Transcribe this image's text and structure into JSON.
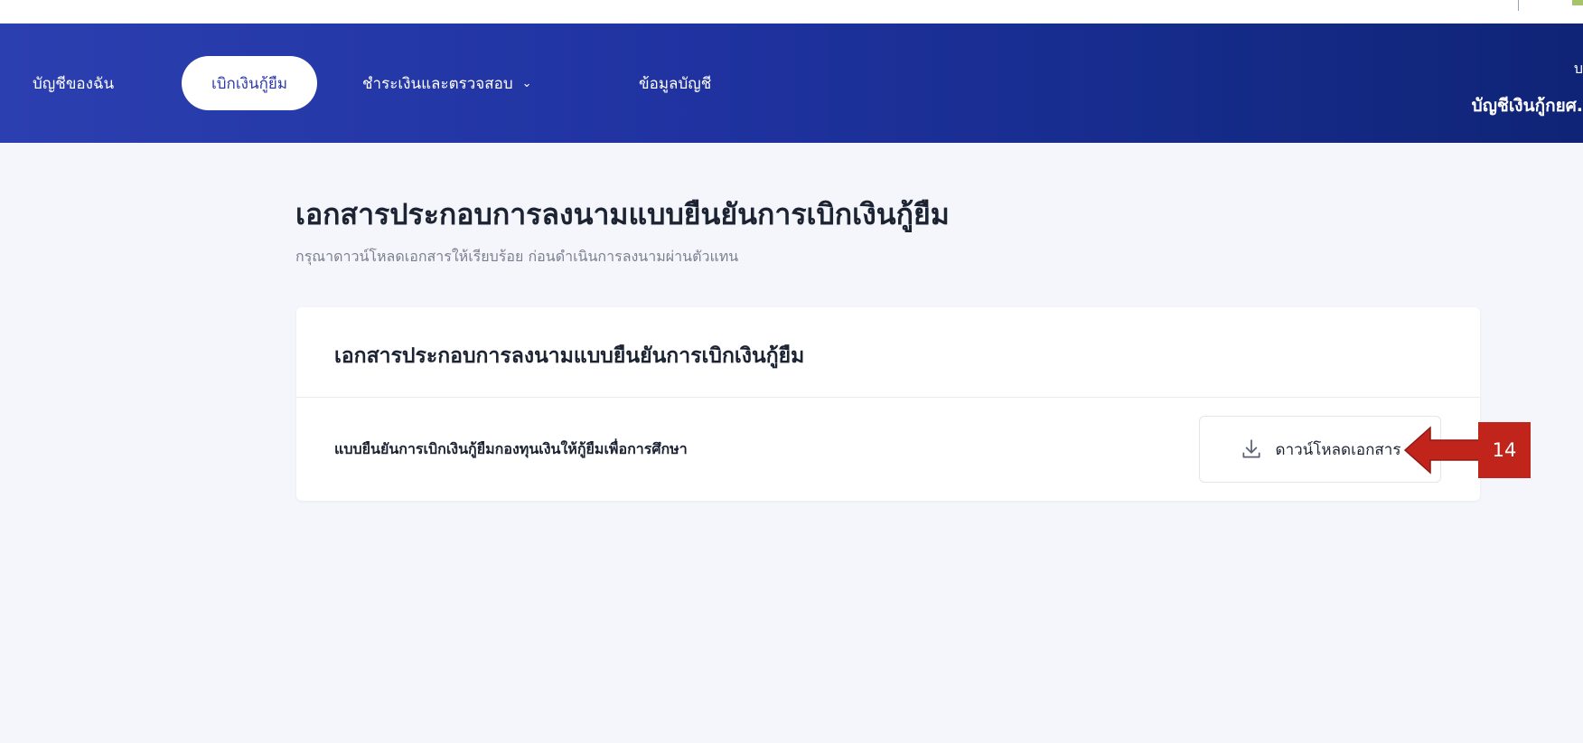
{
  "navbar": {
    "items": [
      {
        "label": "บัญชีของฉัน"
      },
      {
        "label": "เบิกเงินกู้ยืม",
        "active": true
      },
      {
        "label": "ชำระเงินและตรวจสอบ",
        "has_dropdown": true
      },
      {
        "label": "ข้อมูลบัญชี"
      }
    ],
    "account_small": "บ",
    "account_name": "บัญชีเงินกู้กยศ."
  },
  "page": {
    "title": "เอกสารประกอบการลงนามแบบยืนยันการเบิกเงินกู้ยืม",
    "subtitle": "กรุณาดาวน์โหลดเอกสารให้เรียบร้อย ก่อนดำเนินการลงนามผ่านตัวแทน"
  },
  "card": {
    "title": "เอกสารประกอบการลงนามแบบยืนยันการเบิกเงินกู้ยืม",
    "document": {
      "label": "แบบยืนยันการเบิกเงินกู้ยืมกองทุนเงินให้กู้ยืมเพื่อการศึกษา",
      "button_label": "ดาวน์โหลดเอกสาร",
      "button_icon": "download-icon"
    }
  },
  "annotation": {
    "step_number": "14"
  },
  "colors": {
    "navbar_start": "#2c3fb0",
    "navbar_end": "#0f2476",
    "active_pill_text": "#2b3aa8",
    "background": "#f5f6fb",
    "callout": "#c0241a"
  }
}
